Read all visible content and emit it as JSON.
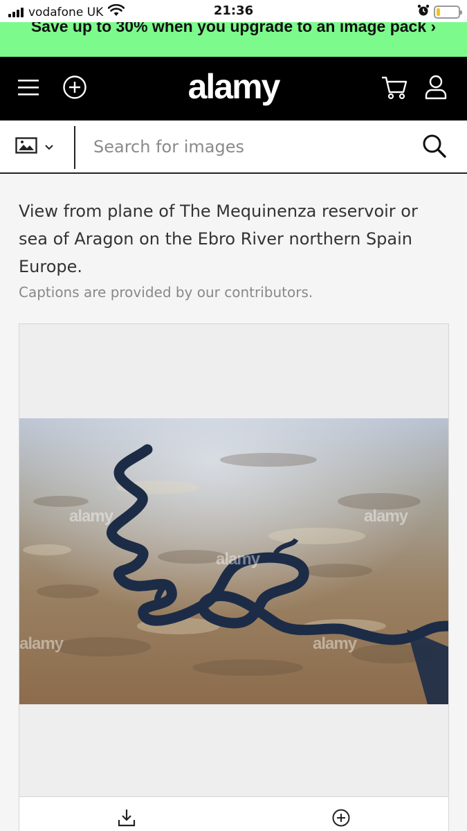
{
  "status_bar": {
    "carrier": "vodafone UK",
    "time": "21:36",
    "battery_level": 0.15,
    "icons": [
      "signal-icon",
      "wifi-icon",
      "alarm-icon",
      "battery-icon"
    ]
  },
  "promo": {
    "text": "Save up to 30% when you upgrade to an image pack ›"
  },
  "header": {
    "logo": "alamy",
    "icons": [
      "menu-icon",
      "plus-circle-icon",
      "cart-icon",
      "user-icon"
    ]
  },
  "search": {
    "placeholder": "Search for images",
    "value": "",
    "type_icon": "image-icon",
    "submit_icon": "search-icon"
  },
  "content": {
    "caption": "View from plane of The Mequinenza reservoir or sea of Aragon on the Ebro River northern Spain Europe.",
    "caption_note": "Captions are provided by our contributors."
  },
  "image": {
    "watermark": "alamy",
    "actions": [
      "download-icon",
      "plus-circle-icon"
    ]
  },
  "colors": {
    "promo_bg": "#7dfa8c",
    "header_bg": "#000000",
    "page_bg": "#f5f5f5",
    "water": "#1c2c47"
  }
}
